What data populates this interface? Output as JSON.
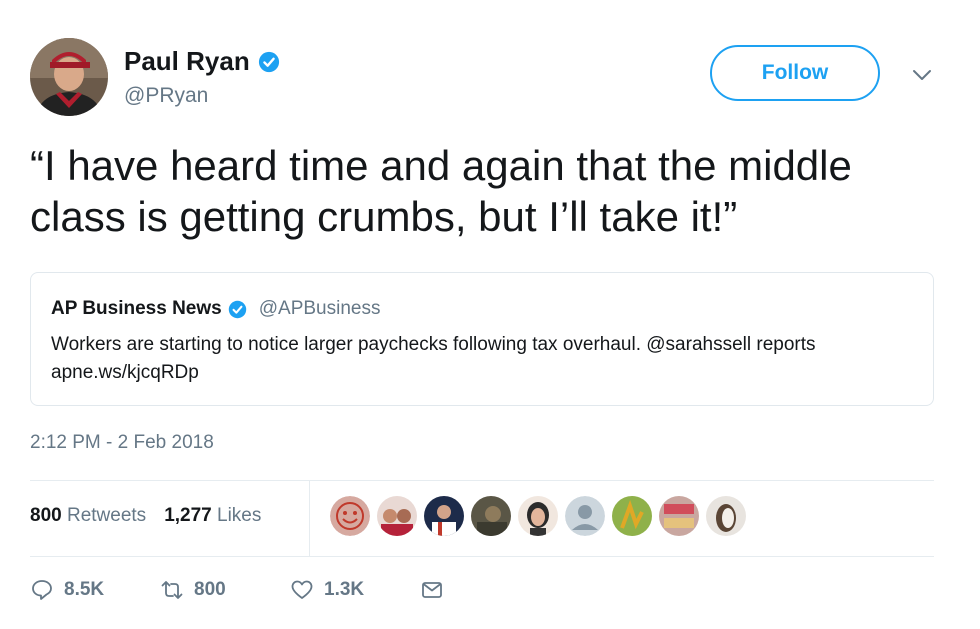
{
  "author": {
    "name": "Paul Ryan",
    "handle": "@PRyan",
    "verified": true,
    "avatar_icon": "profile-photo"
  },
  "follow_label": "Follow",
  "tweet_text": "“I have heard time and again that the middle class is getting crumbs, but I’ll take it!”",
  "quoted": {
    "name": "AP Business News",
    "handle": "@APBusiness",
    "verified": true,
    "text": "Workers are starting to notice larger paychecks following tax overhaul. @sarahssell reports apne.ws/kjcqRDp"
  },
  "timestamp": "2:12 PM - 2 Feb 2018",
  "stats": {
    "retweets_count": "800",
    "retweets_label": "Retweets",
    "likes_count": "1,277",
    "likes_label": "Likes"
  },
  "liker_avatars": [
    "liker-1",
    "liker-2",
    "liker-3",
    "liker-4",
    "liker-5",
    "liker-6",
    "liker-7",
    "liker-8",
    "liker-9"
  ],
  "actions": {
    "reply_count": "8.5K",
    "retweet_count": "800",
    "like_count": "1.3K"
  },
  "colors": {
    "accent": "#1da1f2",
    "secondary_text": "#657786",
    "border": "#e1e8ed"
  }
}
